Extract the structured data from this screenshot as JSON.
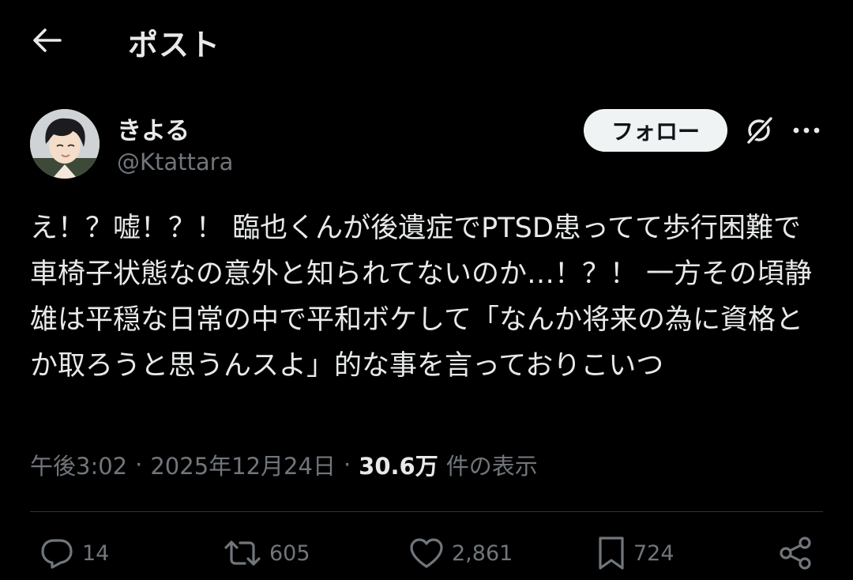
{
  "header": {
    "back_icon": "arrow-left-icon",
    "title": "ポスト"
  },
  "author": {
    "display_name": "きよる",
    "handle": "@Ktattara",
    "avatar_icon": "avatar-image",
    "follow_label": "フォロー",
    "grok_icon": "grok-icon",
    "more_icon": "more-horizontal-icon"
  },
  "tweet": {
    "text": "え！？嘘！？！ 臨也くんが後遺症でPTSD患ってて歩行困難で車椅子状態なの意外と知られてないのか…！？！ 一方その頃静雄は平穏な日常の中で平和ボケして「なんか将来の為に資格とか取ろうと思うんスよ」的な事を言っておりこいつ"
  },
  "meta": {
    "time": "午後3:02",
    "separator": "·",
    "date": "2025年12月24日",
    "views_count": "30.6万",
    "views_label": "件の表示"
  },
  "actions": {
    "reply": {
      "icon": "reply-icon",
      "count": "14"
    },
    "repost": {
      "icon": "repost-icon",
      "count": "605"
    },
    "like": {
      "icon": "heart-icon",
      "count": "2,861"
    },
    "bookmark": {
      "icon": "bookmark-icon",
      "count": "724"
    },
    "share": {
      "icon": "share-icon"
    }
  },
  "colors": {
    "background": "#000000",
    "text_primary": "#e7e9ea",
    "text_secondary": "#71767b",
    "divider": "#2f3336",
    "follow_bg": "#eff3f4"
  }
}
